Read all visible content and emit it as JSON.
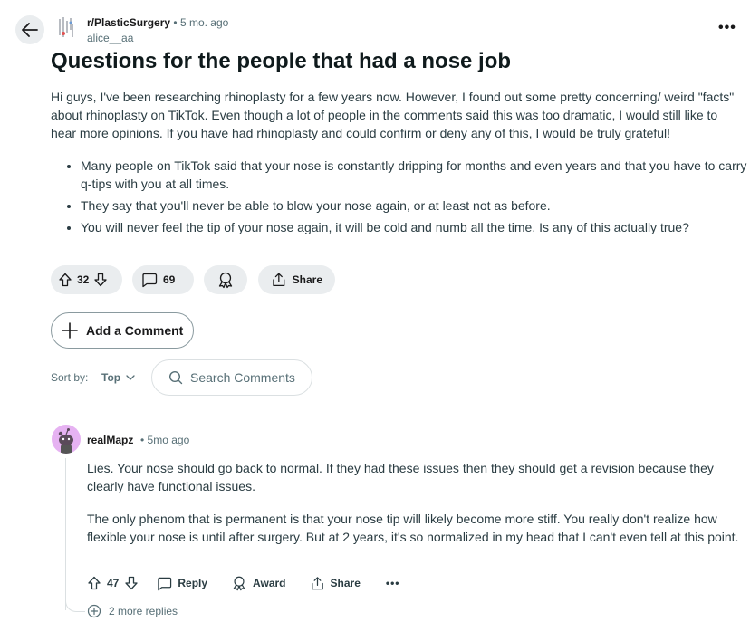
{
  "post": {
    "subreddit": "r/PlasticSurgery",
    "separator": "•",
    "age": "5 mo. ago",
    "author": "alice__aa",
    "title": "Questions for the people that had a nose job",
    "body": "Hi guys, I've been researching rhinoplasty for a few years now. However, I found out some pretty concerning/ weird \"facts\" about rhinoplasty on TikTok. Even though a lot of people in the comments said this was too dramatic, I would still like to hear more opinions. If you have had rhinoplasty and could confirm or deny any of this, I would be truly grateful!",
    "bullets": [
      "Many people on TikTok said that your nose is constantly dripping for months and even years and that you have to carry q-tips with you at all times.",
      "They say that you'll never be able to blow your nose again, or at least not as before.",
      "You will never feel the tip of your nose again, it will be cold and numb all the time. Is any of this actually true?"
    ],
    "score": "32",
    "comment_count": "69",
    "share_label": "Share",
    "more_icon": "more-horizontal-icon"
  },
  "comment_box": {
    "add_label": "Add a Comment"
  },
  "sort": {
    "label": "Sort by:",
    "value": "Top"
  },
  "search": {
    "placeholder": "Search Comments"
  },
  "comment": {
    "author": "realMapz",
    "separator": "•",
    "age": "5mo ago",
    "paragraphs": [
      "Lies. Your nose should go back to normal. If they had these issues then they should get a revision because they clearly have functional issues.",
      "The only phenom that is permanent is that your nose tip will likely become more stiff. You really don't realize how flexible your nose is until after surgery. But at 2 years, it's so normalized in my head that I can't even tell at this point."
    ],
    "score": "47",
    "reply_label": "Reply",
    "award_label": "Award",
    "share_label": "Share",
    "more_replies": "2 more replies"
  },
  "colors": {
    "pill_bg": "#eaedef",
    "avatar_bg": "#e6b2f2",
    "text_muted": "#576f76"
  }
}
